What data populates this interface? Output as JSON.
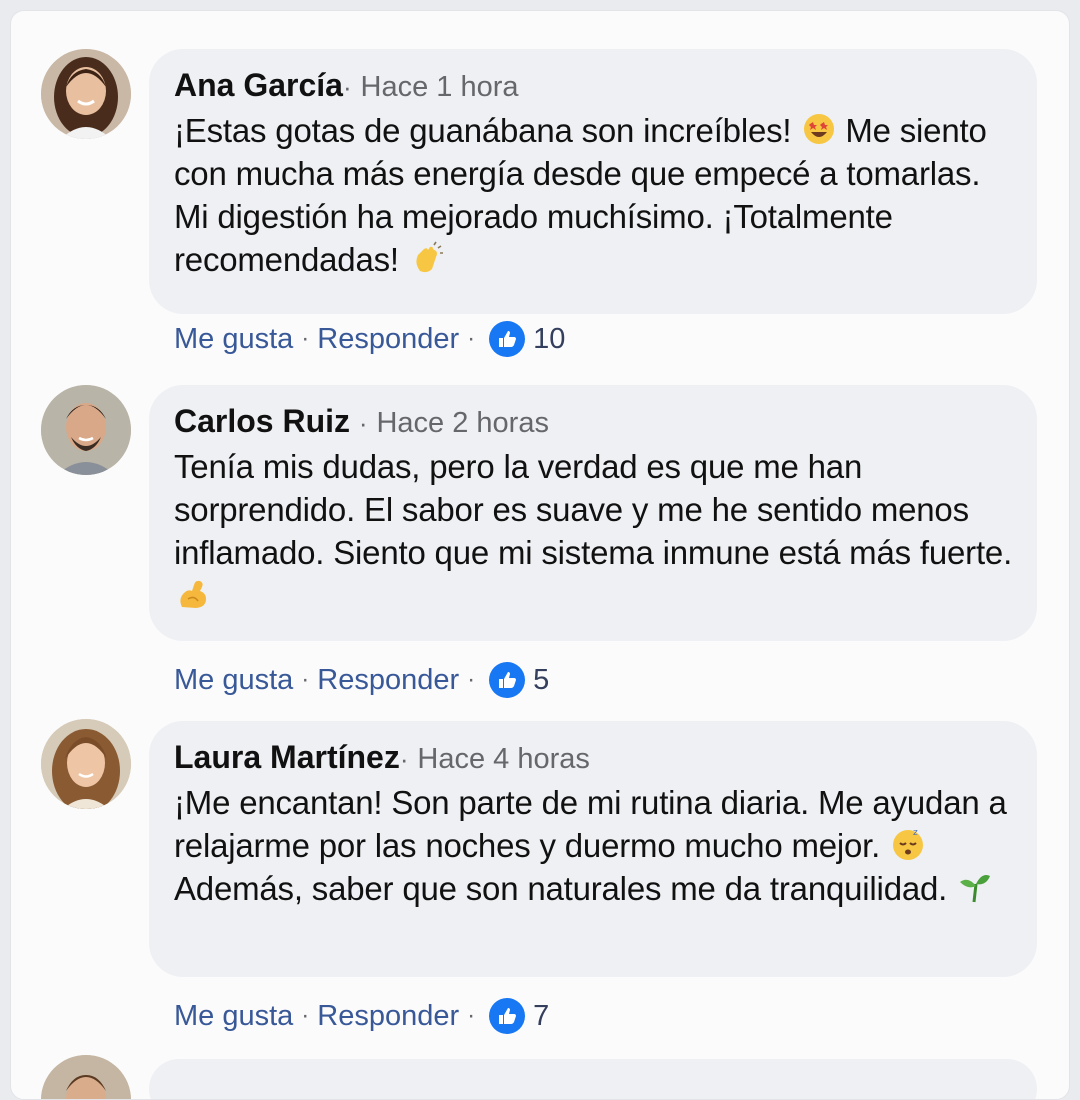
{
  "comments": [
    {
      "author": "Ana García",
      "separator": "·",
      "time": "Hace 1 hora",
      "text": "¡Estas gotas de guanábana son increíbles!",
      "text_after_emoji1": " Me siento con mucha más energía desde que empecé a tomarlas. Mi digestión ha mejorado muchísimo. ¡Totalmente recomendadas!",
      "emoji1": "star-struck-emoji",
      "emoji2": "clapping-hands-emoji",
      "like_label": "Me gusta",
      "reply_label": "Responder",
      "likes": "10"
    },
    {
      "author": "Carlos Ruiz",
      "separator": "·",
      "time": "Hace 2 horas",
      "text": "Tenía mis dudas, pero la verdad es que me han sorprendido. El sabor es suave y me he sentido menos inflamado. Siento que mi sistema inmune está más fuerte.",
      "emoji1": "flexed-biceps-emoji",
      "like_label": "Me gusta",
      "reply_label": "Responder",
      "likes": "5"
    },
    {
      "author": "Laura Martínez",
      "separator": "·",
      "time": "Hace 4 horas",
      "text": "¡Me encantan! Son parte de mi rutina diaria. Me ayudan a relajarme por las noches y duermo mucho mejor.",
      "text_after_emoji1": " Además, saber que son naturales me da tranquilidad.",
      "emoji1": "sleeping-face-emoji",
      "emoji2": "seedling-emoji",
      "like_label": "Me gusta",
      "reply_label": "Responder",
      "likes": "7"
    }
  ],
  "colors": {
    "page_background": "#fbfbfc",
    "bubble": "#eef0f3",
    "link": "#385898",
    "like_badge": "#1877f2",
    "meta_text": "#65676b"
  }
}
